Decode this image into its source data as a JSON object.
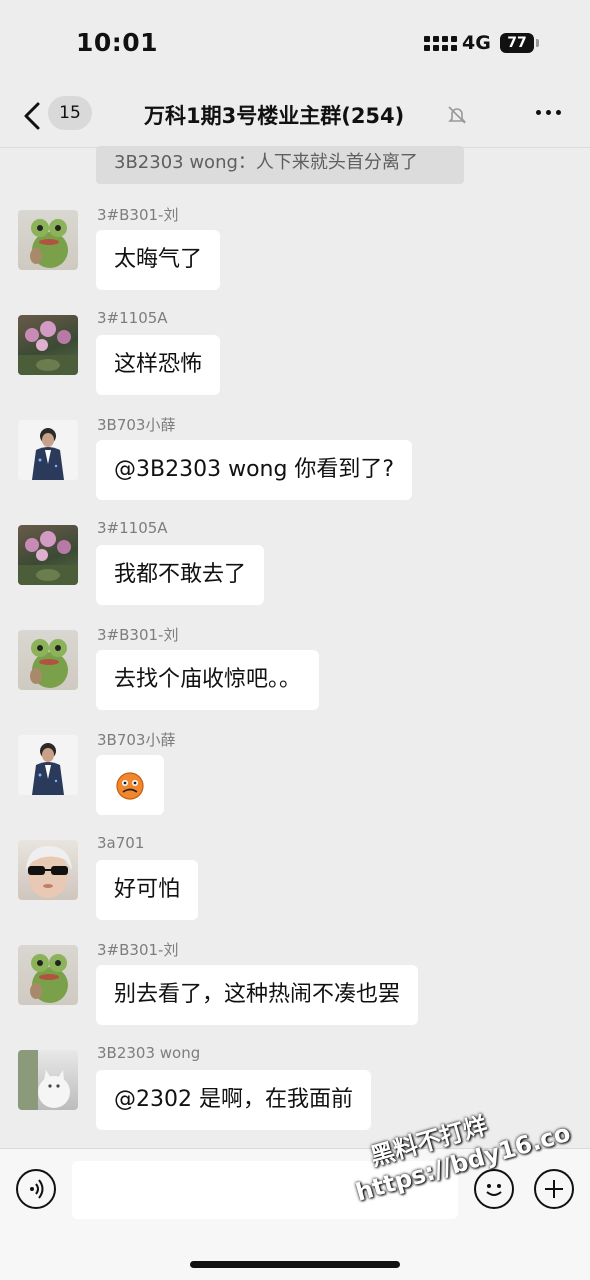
{
  "status_bar": {
    "time": "10:01",
    "network": "4G",
    "battery": "77"
  },
  "nav": {
    "unread_count": "15",
    "title": "万科1期3号楼业主群(254)"
  },
  "quoted_message": "3B2303 wong：人下来就头首分离了",
  "messages": [
    {
      "sender": "3#B301-刘",
      "text": "太晦气了",
      "avatar": "frog-avatar"
    },
    {
      "sender": "3#1105A",
      "text": "这样恐怖",
      "avatar": "flower-avatar"
    },
    {
      "sender": "3B703小薛",
      "text": "@3B2303 wong 你看到了?",
      "avatar": "suit-avatar"
    },
    {
      "sender": "3#1105A",
      "text": "我都不敢去了",
      "avatar": "flower-avatar"
    },
    {
      "sender": "3#B301-刘",
      "text": "去找个庙收惊吧。。",
      "avatar": "frog-avatar"
    },
    {
      "sender": "3B703小薛",
      "text": "",
      "avatar": "suit-avatar",
      "sticker": "scared-emoji"
    },
    {
      "sender": "3a701",
      "text": "好可怕",
      "avatar": "girl-avatar"
    },
    {
      "sender": "3#B301-刘",
      "text": "别去看了，这种热闹不凑也罢",
      "avatar": "frog-avatar"
    },
    {
      "sender": "3B2303 wong",
      "text": "@2302 是啊，在我面前",
      "avatar": "cat-avatar"
    }
  ],
  "input": {
    "value": "",
    "placeholder": ""
  },
  "watermark": {
    "line1": "黑料不打烊",
    "line2": "https://bdy16.co"
  },
  "colors": {
    "background": "#ededed",
    "bubble": "#ffffff",
    "sender_text": "#7d7d7d"
  }
}
